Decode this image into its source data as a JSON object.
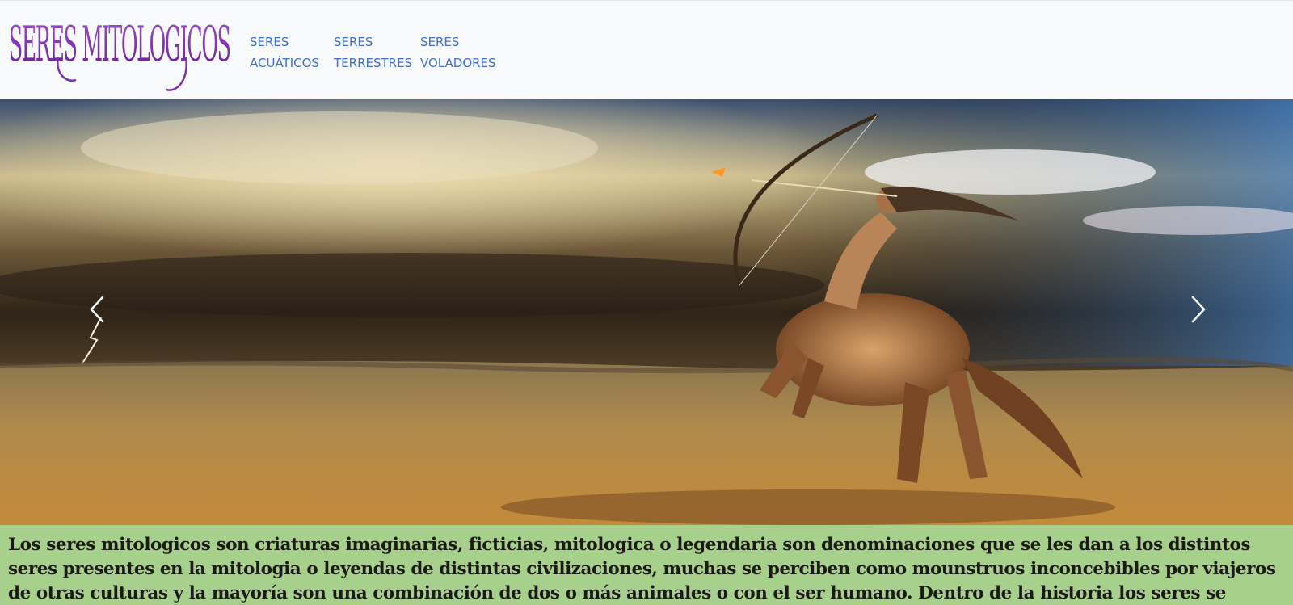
{
  "brand": {
    "logo_text": "SERES MITOLOGICOS",
    "logo_color": "#7b2fa8"
  },
  "nav": {
    "items": [
      {
        "line1": "SERES",
        "line2": "ACUÁTICOS"
      },
      {
        "line1": "SERES",
        "line2": "TERRESTRES"
      },
      {
        "line1": "SERES",
        "line2": "VOLADORES"
      }
    ],
    "link_color": "#3f6fd0"
  },
  "carousel": {
    "image": "centaur-archer-storm-desert",
    "prev_icon": "chevron-left-icon",
    "next_icon": "chevron-right-icon"
  },
  "intro": {
    "text": "Los seres mitologicos son criaturas imaginarias, ficticias, mitologica o legendaria son denominaciones que se les dan a los distintos seres presentes en la mitologia o leyendas de distintas civilizaciones, muchas se perciben como mounstruos inconcebibles por viajeros de otras culturas y la mayoría son una combinación de dos o más animales o con el ser humano. Dentro de la historia los seres se encontraban en",
    "background": "#a8d08d"
  }
}
